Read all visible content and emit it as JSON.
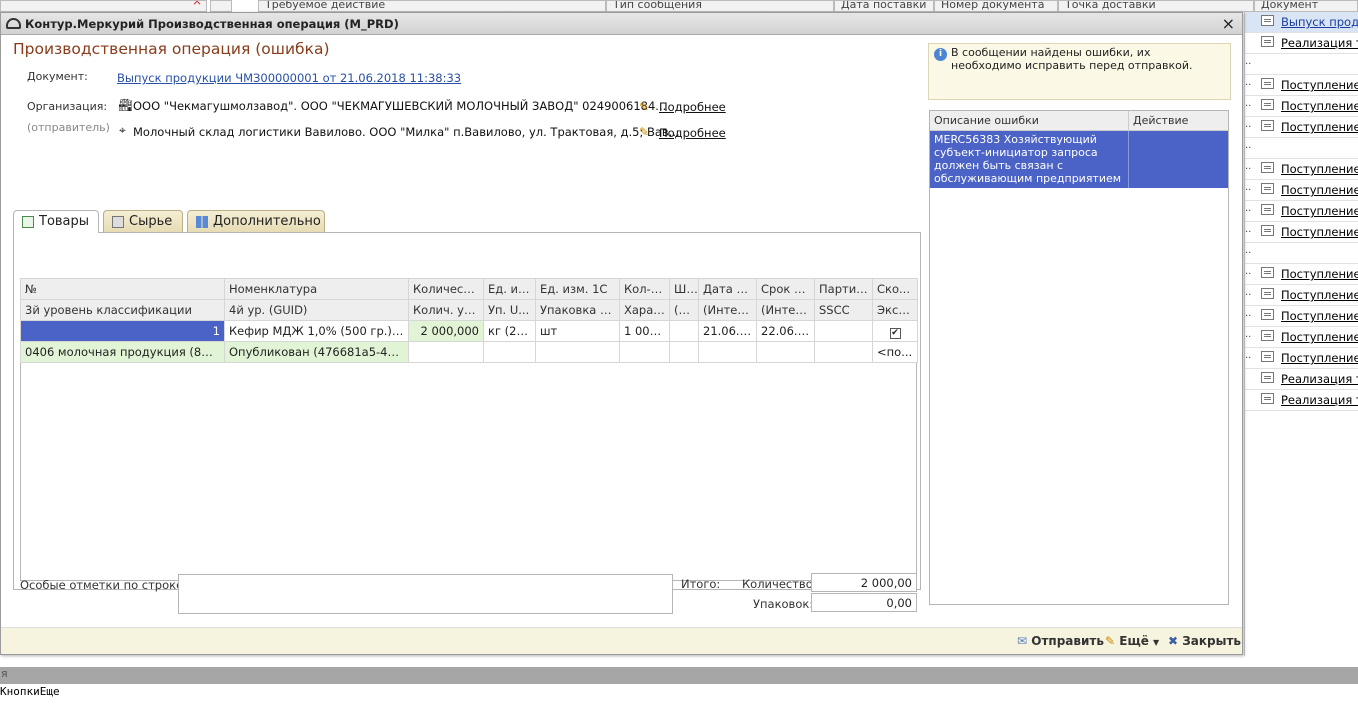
{
  "background": {
    "top_columns": [
      "Требуемое действие",
      "Тип сообщения",
      "Дата поставки",
      "Номер документа",
      "Точка доставки",
      "Документ"
    ],
    "right_list": [
      {
        "dots": "",
        "label": "Выпуск проду",
        "selected": true
      },
      {
        "dots": "",
        "label": "Реализация то",
        "selected": false
      },
      {
        "dots": "..",
        "label": "",
        "selected": false
      },
      {
        "dots": "..",
        "label": "Поступление т",
        "selected": false
      },
      {
        "dots": "..",
        "label": "Поступление т",
        "selected": false
      },
      {
        "dots": "..",
        "label": "Поступление т",
        "selected": false
      },
      {
        "dots": "..",
        "label": "",
        "selected": false
      },
      {
        "dots": "..",
        "label": "Поступление т",
        "selected": false
      },
      {
        "dots": "..",
        "label": "Поступление т",
        "selected": false
      },
      {
        "dots": "..",
        "label": "Поступление т",
        "selected": false
      },
      {
        "dots": "..",
        "label": "Поступление т",
        "selected": false
      },
      {
        "dots": "..",
        "label": "",
        "selected": false
      },
      {
        "dots": "..",
        "label": "Поступление т",
        "selected": false
      },
      {
        "dots": "..",
        "label": "Поступление т",
        "selected": false
      },
      {
        "dots": "..",
        "label": "Поступление т",
        "selected": false
      },
      {
        "dots": "..",
        "label": "Поступление т",
        "selected": false
      },
      {
        "dots": "..",
        "label": "Поступление т",
        "selected": false
      },
      {
        "dots": "",
        "label": "Реализация то",
        "selected": false
      },
      {
        "dots": "",
        "label": "Реализация то",
        "selected": false
      }
    ],
    "status_text": "я",
    "code_text": "КнопкиЕще"
  },
  "window": {
    "title": "Контур.Меркурий Производственная операция (M_PRD)",
    "close": "×",
    "heading": "Производственная операция (ошибка)",
    "document_label": "Документ:",
    "document_link": "Выпуск продукции ЧМЗ00000001 от 21.06.2018 11:38:33",
    "org_label": "Организация:",
    "org_sublabel": "(отправитель)",
    "org_value": "ООО \"Чекмагушмолзавод\". ООО \"ЧЕКМАГУШЕВСКИЙ МОЛОЧНЫЙ ЗАВОД\" 0249006184...",
    "org_more": "Подробнее",
    "warehouse_value": "Молочный склад логистики Вавилово. ООО \"Милка\" п.Вавилово, ул. Трактовая, д.5; Вав...",
    "warehouse_more": "Подробнее"
  },
  "tabs": [
    {
      "label": "Товары",
      "active": true
    },
    {
      "label": "Сырье",
      "active": false
    },
    {
      "label": "Дополнительно",
      "active": false
    }
  ],
  "grid": {
    "header1": [
      "№",
      "Номенклатура",
      "Количество",
      "Ед. из...",
      "Ед. изм. 1С",
      "Кол-в...",
      "Ш...",
      "Дата п...",
      "Срок г...",
      "Партия...",
      "Ско..."
    ],
    "header2": [
      "3й уровень классификации",
      "4й ур. (GUID)",
      "Колич. уп...",
      "Уп. U...",
      "Упаковка 1С",
      "Харак...",
      "(G...",
      "(Интер...",
      "(Интер...",
      "SSCC",
      "Эксп..."
    ],
    "row1": [
      "1",
      "Кефир  МДЖ 1,0% (500 гр.) пл...",
      "2 000,000",
      "кг (21...",
      "шт",
      "1 000,...",
      "",
      "21.06.2...",
      "22.06.2...",
      "",
      "✔"
    ],
    "row2": [
      "0406 молочная продукция (870са...",
      "Опубликован (476681a5-4d15-...",
      "",
      "",
      "",
      "",
      "",
      "",
      "",
      "",
      "<по..."
    ]
  },
  "footer": {
    "notes_label": "Особые отметки по строке:",
    "total_label": "Итого:",
    "qty_label": "Количество:",
    "qty_value": "2 000,00",
    "pack_label": "Упаковок:",
    "pack_value": "0,00"
  },
  "errors": {
    "hint": "В сообщении найдены ошибки, их необходимо исправить перед отправкой.",
    "col_desc": "Описание ошибки",
    "col_action": "Действие",
    "rows": [
      {
        "desc": "MERC56383 Хозяйствующий субъект-инициатор запроса должен быть связан с обслуживающим предприятием",
        "action": ""
      }
    ]
  },
  "actions": {
    "send": "Отправить",
    "more": "Ещё",
    "close": "Закрыть"
  },
  "colors": {
    "heading": "#8a3c1a",
    "selection": "#4b63c6",
    "link": "#2850a8",
    "row_highlight": "#e2f4d6"
  }
}
